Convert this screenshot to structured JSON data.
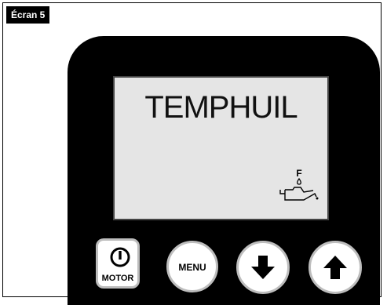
{
  "screen_tag": "Écran 5",
  "display": {
    "text": "TEMPHUIL",
    "oil_indicator": {
      "icon": "oil-can-icon",
      "label": "F"
    }
  },
  "buttons": {
    "motor": {
      "label": "MOTOR",
      "icon": "power-icon"
    },
    "menu": {
      "label": "MENU"
    },
    "down": {
      "icon": "arrow-down-icon"
    },
    "up": {
      "icon": "arrow-up-icon"
    }
  },
  "colors": {
    "device_body": "#000000",
    "lcd_background": "#e5e5e5",
    "button_ring": "#bdbdbd"
  }
}
